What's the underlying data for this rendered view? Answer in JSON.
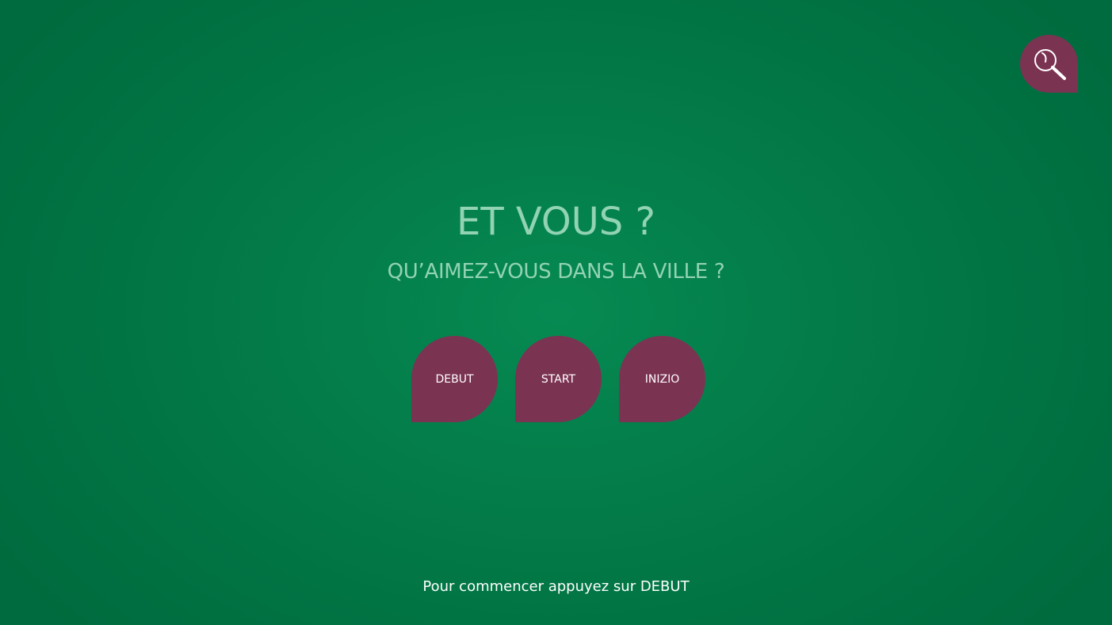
{
  "screen": {
    "title": "ET VOUS ?",
    "subtitle": "QU’AIMEZ-VOUS DANS LA VILLE ?",
    "instruction": "Pour commencer appuyez sur DEBUT"
  },
  "search_button": {
    "icon": "magnifier-icon"
  },
  "languages": [
    {
      "label": "DEBUT"
    },
    {
      "label": "START"
    },
    {
      "label": "INIZIO"
    }
  ],
  "colors": {
    "background": "#047f4b",
    "accent": "#7b3352",
    "title_text": "#92d3b3",
    "button_text": "#ffffff"
  }
}
